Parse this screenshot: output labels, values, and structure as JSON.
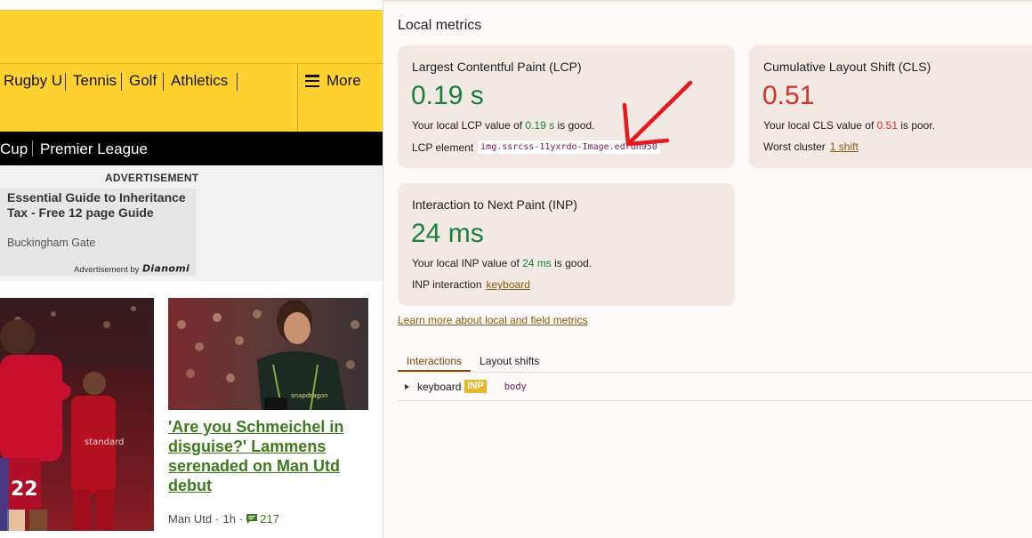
{
  "site": {
    "nav": {
      "items": [
        "Rugby U",
        "Tennis",
        "Golf",
        "Athletics"
      ],
      "more_label": "More"
    },
    "subnav": {
      "items": [
        "Cup",
        "Premier League"
      ]
    },
    "ad": {
      "label": "ADVERTISEMENT",
      "title": "Essential Guide to Inheritance Tax - Free 12 page Guide",
      "source": "Buckingham Gate",
      "by_label": "Advertisement by",
      "by_brand": "Dianomi"
    },
    "story": {
      "headline": "'Are you Schmeichel in disguise?' Lammens serenaded on Man Utd debut",
      "section": "Man Utd",
      "age": "1h",
      "comments": "217"
    },
    "colors": {
      "brand_yellow": "#ffd230",
      "link_green": "#3d7a1d"
    }
  },
  "devtools": {
    "heading": "Local metrics",
    "lcp": {
      "title": "Largest Contentful Paint (LCP)",
      "value": "0.19 s",
      "desc_prefix": "Your local LCP value of ",
      "desc_value": "0.19 s",
      "desc_suffix": " is good.",
      "element_label": "LCP element",
      "element_selector": "img.ssrcss-11yxrdo-Image.edrdn950"
    },
    "cls": {
      "title": "Cumulative Layout Shift (CLS)",
      "value": "0.51",
      "desc_prefix": "Your local CLS value of ",
      "desc_value": "0.51",
      "desc_suffix": " is poor.",
      "cluster_label": "Worst cluster",
      "cluster_link": "1 shift"
    },
    "inp": {
      "title": "Interaction to Next Paint (INP)",
      "value": "24 ms",
      "desc_prefix": "Your local INP value of ",
      "desc_value": "24 ms",
      "desc_suffix": " is good.",
      "interaction_label": "INP interaction",
      "interaction_link": "keyboard"
    },
    "learn_more": "Learn more about local and field metrics",
    "tabs": [
      "Interactions",
      "Layout shifts"
    ],
    "interactions": [
      {
        "type": "keyboard",
        "badge": "INP",
        "target": "body"
      }
    ],
    "colors": {
      "good": "#188038",
      "poor": "#d93025",
      "annotation_arrow": "#e8191b"
    }
  }
}
